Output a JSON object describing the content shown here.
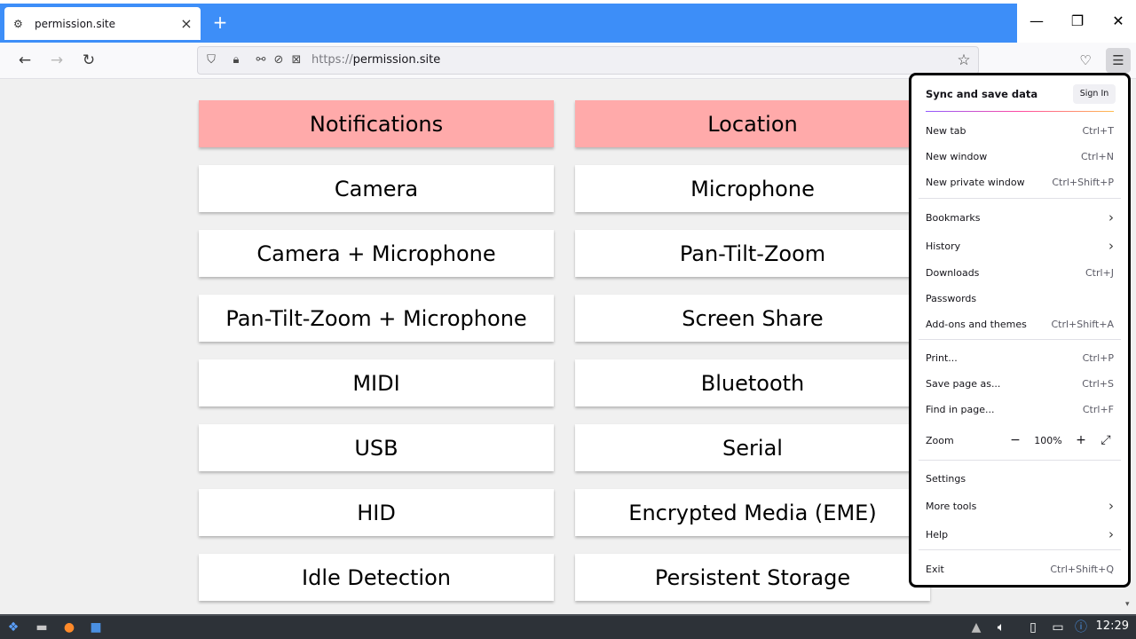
{
  "browser": {
    "tab_title": "permission.site",
    "new_tab_symbol": "+",
    "url_scheme": "https://",
    "url_host": "permission.site"
  },
  "permissions": [
    {
      "label": "Notifications",
      "highlight": true
    },
    {
      "label": "Location",
      "highlight": true
    },
    {
      "label": "Camera",
      "highlight": false
    },
    {
      "label": "Microphone",
      "highlight": false
    },
    {
      "label": "Camera + Microphone",
      "highlight": false
    },
    {
      "label": "Pan-Tilt-Zoom",
      "highlight": false
    },
    {
      "label": "Pan-Tilt-Zoom + Microphone",
      "highlight": false
    },
    {
      "label": "Screen Share",
      "highlight": false
    },
    {
      "label": "MIDI",
      "highlight": false
    },
    {
      "label": "Bluetooth",
      "highlight": false
    },
    {
      "label": "USB",
      "highlight": false
    },
    {
      "label": "Serial",
      "highlight": false
    },
    {
      "label": "HID",
      "highlight": false
    },
    {
      "label": "Encrypted Media (EME)",
      "highlight": false
    },
    {
      "label": "Idle Detection",
      "highlight": false
    },
    {
      "label": "Persistent Storage",
      "highlight": false
    }
  ],
  "menu": {
    "sync_title": "Sync and save data",
    "sign_in": "Sign In",
    "new_tab": "New tab",
    "new_tab_sc": "Ctrl+T",
    "new_window": "New window",
    "new_window_sc": "Ctrl+N",
    "new_private": "New private window",
    "new_private_sc": "Ctrl+Shift+P",
    "bookmarks": "Bookmarks",
    "history": "History",
    "downloads": "Downloads",
    "downloads_sc": "Ctrl+J",
    "passwords": "Passwords",
    "addons": "Add-ons and themes",
    "addons_sc": "Ctrl+Shift+A",
    "print": "Print...",
    "print_sc": "Ctrl+P",
    "save_page": "Save page as...",
    "save_page_sc": "Ctrl+S",
    "find": "Find in page...",
    "find_sc": "Ctrl+F",
    "zoom": "Zoom",
    "zoom_minus": "−",
    "zoom_value": "100%",
    "zoom_plus": "+",
    "settings": "Settings",
    "more_tools": "More tools",
    "help": "Help",
    "exit": "Exit",
    "exit_sc": "Ctrl+Shift+Q"
  },
  "taskbar": {
    "clock": "12:29"
  },
  "colors": {
    "tabstrip_accent": "#3d8ef8",
    "highlight_button": "#ffaaaa"
  }
}
